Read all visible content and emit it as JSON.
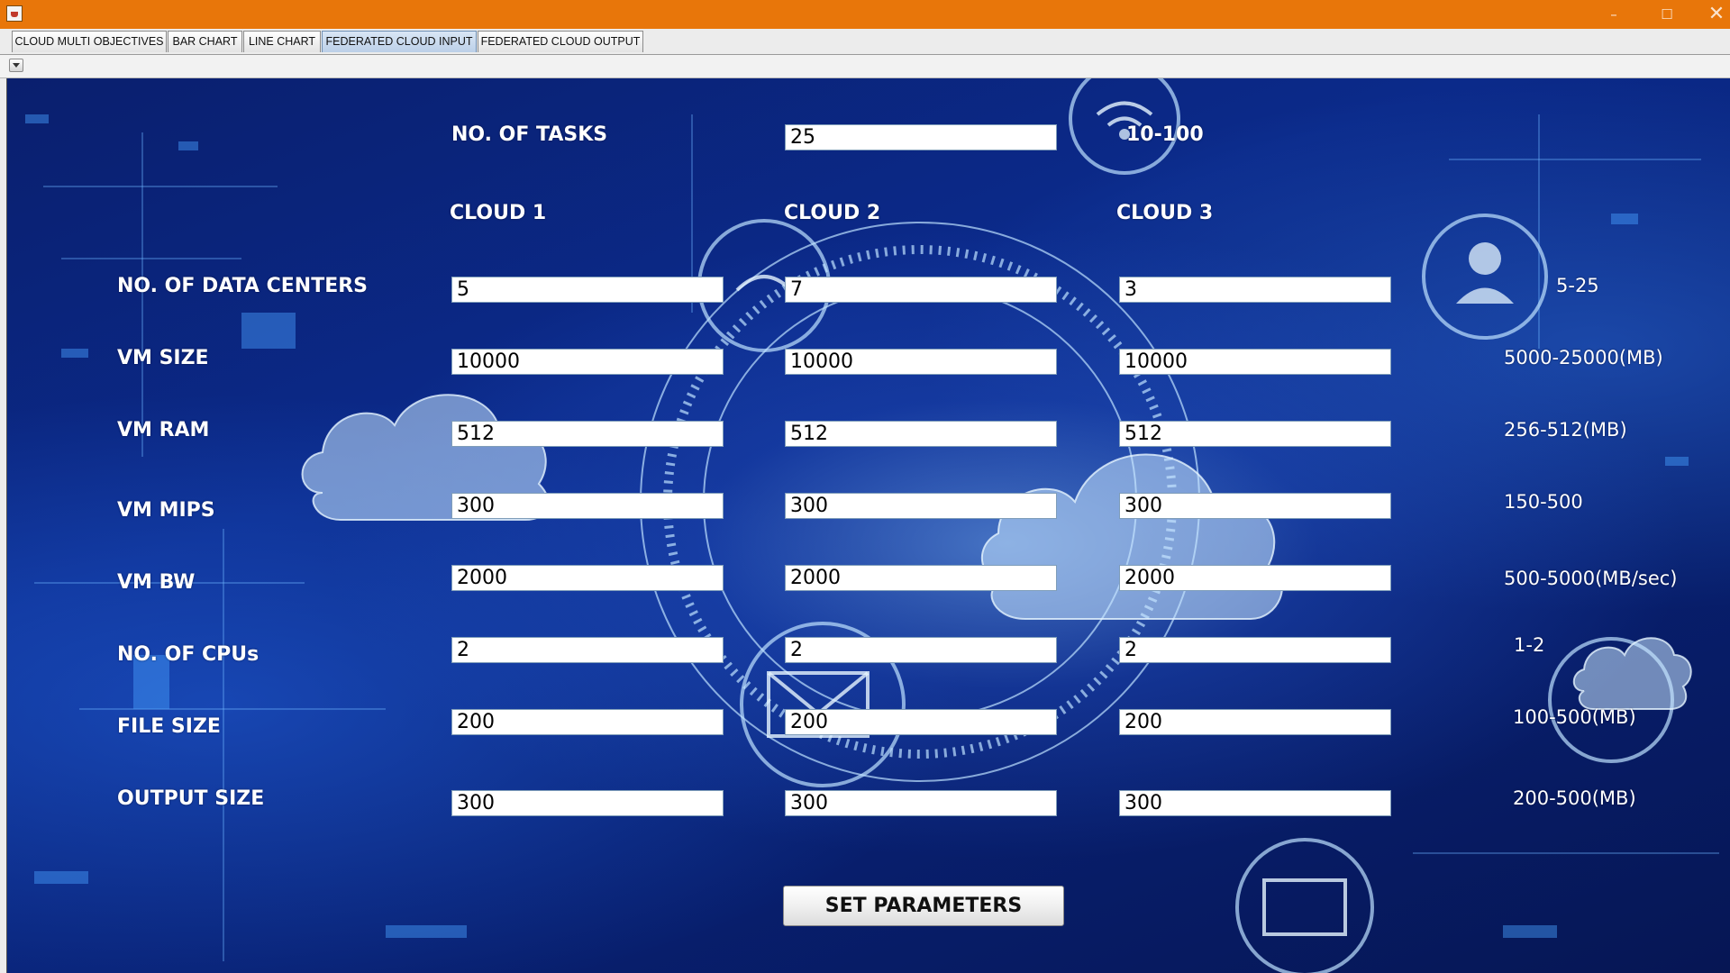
{
  "tabs": [
    {
      "label": "CLOUD MULTI OBJECTIVES",
      "active": false
    },
    {
      "label": "BAR CHART",
      "active": false
    },
    {
      "label": "LINE CHART",
      "active": false
    },
    {
      "label": "FEDERATED CLOUD INPUT",
      "active": true
    },
    {
      "label": "FEDERATED CLOUD OUTPUT",
      "active": false
    }
  ],
  "window_controls": {
    "minimize": "–",
    "maximize": "☐",
    "close": "✕"
  },
  "tasks": {
    "label": "NO. OF TASKS",
    "value": "25",
    "range": "10-100"
  },
  "clouds": [
    "CLOUD 1",
    "CLOUD 2",
    "CLOUD 3"
  ],
  "params": [
    {
      "label": "NO. OF DATA CENTERS",
      "values": [
        "5",
        "7",
        "3"
      ],
      "range": "5-25"
    },
    {
      "label": "VM SIZE",
      "values": [
        "10000",
        "10000",
        "10000"
      ],
      "range": "5000-25000(MB)"
    },
    {
      "label": "VM RAM",
      "values": [
        "512",
        "512",
        "512"
      ],
      "range": "256-512(MB)"
    },
    {
      "label": "VM MIPS",
      "values": [
        "300",
        "300",
        "300"
      ],
      "range": "150-500"
    },
    {
      "label": "VM BW",
      "values": [
        "2000",
        "2000",
        "2000"
      ],
      "range": "500-5000(MB/sec)"
    },
    {
      "label": "NO. OF CPUs",
      "values": [
        "2",
        "2",
        "2"
      ],
      "range": "1-2"
    },
    {
      "label": "FILE SIZE",
      "values": [
        "200",
        "200",
        "200"
      ],
      "range": "100-500(MB)"
    },
    {
      "label": "OUTPUT SIZE",
      "values": [
        "300",
        "300",
        "300"
      ],
      "range": "200-500(MB)"
    }
  ],
  "set_button": "SET PARAMETERS",
  "icons": {
    "app": "java-app-icon",
    "collapse": "chevron-down-icon",
    "background": "cloud-network-background"
  },
  "colors": {
    "titlebar": "#e8760a",
    "panel_background": "#0b2a8a",
    "label_text": "#ffffff"
  }
}
